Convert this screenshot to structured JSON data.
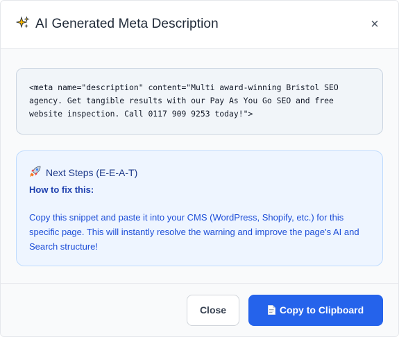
{
  "modal": {
    "title": "AI Generated Meta Description",
    "title_icon": "sparkles-icon",
    "close_glyph": "×"
  },
  "snippet": {
    "code": "<meta name=\"description\" content=\"Multi award-winning Bristol SEO agency. Get tangible results with our Pay As You Go SEO and free website inspection. Call 0117 909 9253 today!\">"
  },
  "next_steps": {
    "icon": "rocket-icon",
    "heading": "Next Steps (E-E-A-T)",
    "subheading": "How to fix this:",
    "text": "Copy this snippet and paste it into your CMS (WordPress, Shopify, etc.) for this specific page. This will instantly resolve the warning and improve the page's AI and Search structure!"
  },
  "footer": {
    "close_label": "Close",
    "copy_label": "Copy to Clipboard",
    "copy_icon": "document-icon"
  },
  "colors": {
    "accent": "#2563eb",
    "steps_bg": "#eef5ff",
    "code_bg": "#f1f5f9"
  }
}
